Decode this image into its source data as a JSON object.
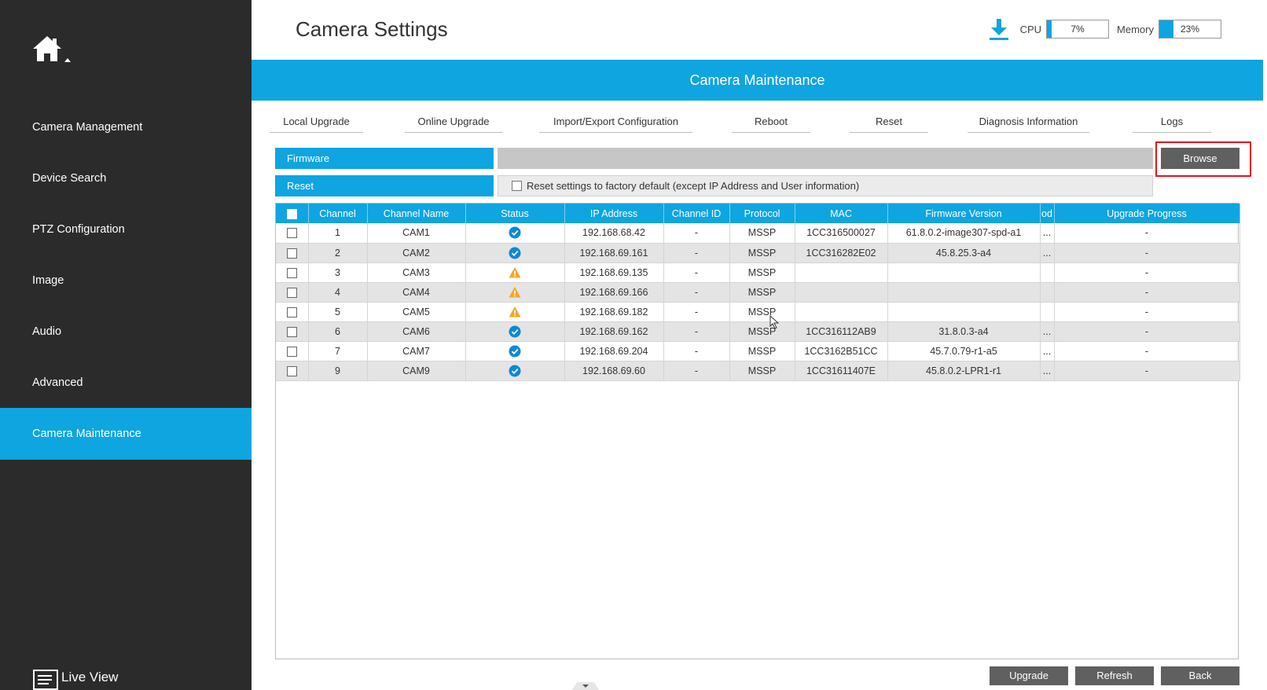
{
  "sidebar": {
    "items": [
      {
        "label": "Camera Management"
      },
      {
        "label": "Device Search"
      },
      {
        "label": "PTZ Configuration"
      },
      {
        "label": "Image"
      },
      {
        "label": "Audio"
      },
      {
        "label": "Advanced"
      },
      {
        "label": "Camera Maintenance",
        "active": true
      }
    ],
    "live_view": "Live View"
  },
  "header": {
    "title": "Camera Settings",
    "cpu_label": "CPU",
    "cpu_value": "7%",
    "cpu_fraction": 0.07,
    "memory_label": "Memory",
    "memory_value": "23%",
    "memory_fraction": 0.23
  },
  "section": {
    "title": "Camera Maintenance"
  },
  "tabs": [
    {
      "label": "Local Upgrade",
      "active": true
    },
    {
      "label": "Online Upgrade"
    },
    {
      "label": "Import/Export Configuration"
    },
    {
      "label": "Reboot"
    },
    {
      "label": "Reset"
    },
    {
      "label": "Diagnosis Information"
    },
    {
      "label": "Logs"
    }
  ],
  "firmware": {
    "label": "Firmware",
    "path": "",
    "browse_label": "Browse"
  },
  "reset": {
    "label": "Reset",
    "option_text": "Reset settings to factory default (except IP Address and User information)"
  },
  "table": {
    "headers": [
      "Channel",
      "Channel Name",
      "Status",
      "IP Address",
      "Channel ID",
      "Protocol",
      "MAC",
      "Firmware Version",
      "od",
      "Upgrade Progress"
    ],
    "rows": [
      {
        "channel": "1",
        "name": "CAM1",
        "status": "online",
        "ip": "192.168.68.42",
        "channel_id": "-",
        "protocol": "MSSP",
        "mac": "1CC316500027",
        "firmware": "61.8.0.2-image307-spd-a1",
        "od": "...",
        "progress": "-"
      },
      {
        "channel": "2",
        "name": "CAM2",
        "status": "online",
        "ip": "192.168.69.161",
        "channel_id": "-",
        "protocol": "MSSP",
        "mac": "1CC316282E02",
        "firmware": "45.8.25.3-a4",
        "od": "...",
        "progress": "-"
      },
      {
        "channel": "3",
        "name": "CAM3",
        "status": "warning",
        "ip": "192.168.69.135",
        "channel_id": "-",
        "protocol": "MSSP",
        "mac": "",
        "firmware": "",
        "od": "",
        "progress": "-"
      },
      {
        "channel": "4",
        "name": "CAM4",
        "status": "warning",
        "ip": "192.168.69.166",
        "channel_id": "-",
        "protocol": "MSSP",
        "mac": "",
        "firmware": "",
        "od": "",
        "progress": "-"
      },
      {
        "channel": "5",
        "name": "CAM5",
        "status": "warning",
        "ip": "192.168.69.182",
        "channel_id": "-",
        "protocol": "MSSP",
        "mac": "",
        "firmware": "",
        "od": "",
        "progress": "-"
      },
      {
        "channel": "6",
        "name": "CAM6",
        "status": "online",
        "ip": "192.168.69.162",
        "channel_id": "-",
        "protocol": "MSSP",
        "mac": "1CC316112AB9",
        "firmware": "31.8.0.3-a4",
        "od": "...",
        "progress": "-"
      },
      {
        "channel": "7",
        "name": "CAM7",
        "status": "online",
        "ip": "192.168.69.204",
        "channel_id": "-",
        "protocol": "MSSP",
        "mac": "1CC3162B51CC",
        "firmware": "45.7.0.79-r1-a5",
        "od": "...",
        "progress": "-"
      },
      {
        "channel": "9",
        "name": "CAM9",
        "status": "online",
        "ip": "192.168.69.60",
        "channel_id": "-",
        "protocol": "MSSP",
        "mac": "1CC31611407E",
        "firmware": "45.8.0.2-LPR1-r1",
        "od": "...",
        "progress": "-"
      }
    ]
  },
  "footer": {
    "upgrade_label": "Upgrade",
    "refresh_label": "Refresh",
    "back_label": "Back"
  },
  "colors": {
    "accent": "#0ea5e0",
    "sidebar": "#2b2b2b",
    "button": "#606060",
    "warning": "#f5a623",
    "highlight": "#e3141e"
  }
}
